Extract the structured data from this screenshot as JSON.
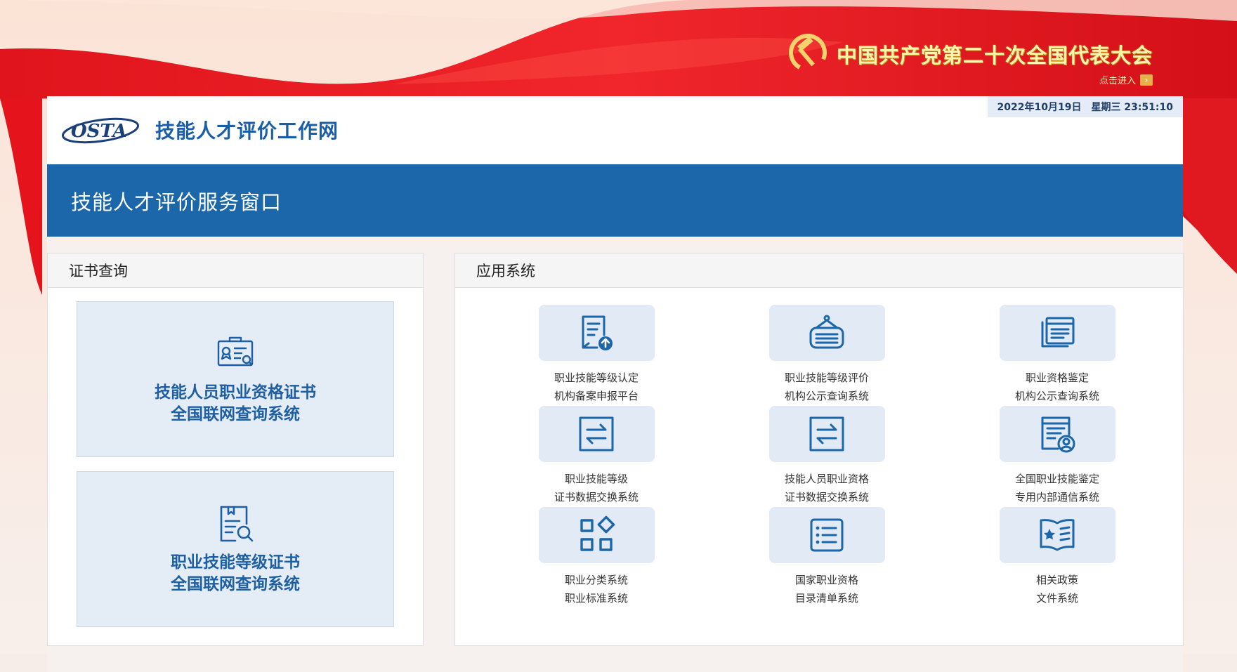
{
  "banner": {
    "title": "中国共产党第二十次全国代表大会",
    "enter_label": "点击进入",
    "enter_arrow": "›"
  },
  "header": {
    "logo_text": "OSTA",
    "site_title": "技能人才评价工作网",
    "date": "2022年10月19日",
    "weekday_time": "星期三 23:51:10"
  },
  "service_bar": {
    "title": "技能人才评价服务窗口"
  },
  "cert_panel": {
    "title": "证书查询",
    "cards": [
      {
        "line1": "技能人员职业资格证书",
        "line2": "全国联网查询系统",
        "icon": "certificate-search-icon"
      },
      {
        "line1": "职业技能等级证书",
        "line2": "全国联网查询系统",
        "icon": "document-search-icon"
      }
    ]
  },
  "app_panel": {
    "title": "应用系统",
    "items": [
      {
        "line1": "职业技能等级认定",
        "line2": "机构备案申报平台",
        "icon": "document-upload-icon"
      },
      {
        "line1": "职业技能等级评价",
        "line2": "机构公示查询系统",
        "icon": "hanging-sign-icon"
      },
      {
        "line1": "职业资格鉴定",
        "line2": "机构公示查询系统",
        "icon": "stacked-documents-icon"
      },
      {
        "line1": "职业技能等级",
        "line2": "证书数据交换系统",
        "icon": "exchange-arrows-icon"
      },
      {
        "line1": "技能人员职业资格",
        "line2": "证书数据交换系统",
        "icon": "exchange-arrows-icon"
      },
      {
        "line1": "全国职业技能鉴定",
        "line2": "专用内部通信系统",
        "icon": "document-user-icon"
      },
      {
        "line1": "职业分类系统",
        "line2": "职业标准系统",
        "icon": "category-grid-icon"
      },
      {
        "line1": "国家职业资格",
        "line2": "目录清单系统",
        "icon": "bulleted-list-icon"
      },
      {
        "line1": "相关政策",
        "line2": "文件系统",
        "icon": "star-book-icon"
      }
    ]
  },
  "colors": {
    "primary_blue": "#1b67a9",
    "title_blue": "#1a5ea8",
    "card_bg": "#e4ecf6",
    "banner_red": "#d8121c"
  }
}
